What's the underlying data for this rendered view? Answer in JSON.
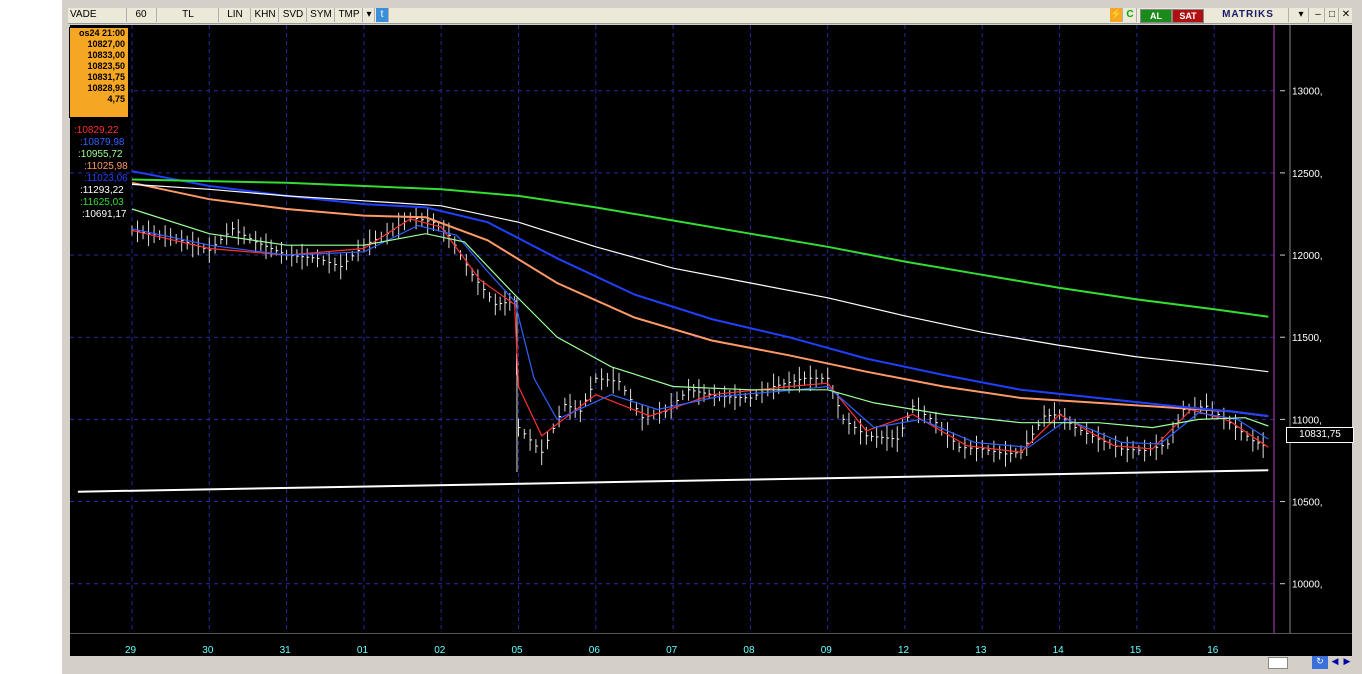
{
  "toolbar": {
    "symbol": "VADE",
    "period": "60",
    "currency": "TL",
    "scale": "LIN",
    "buttons": [
      "KHN",
      "SVD",
      "SYM",
      "TMP"
    ],
    "buy_label": "AL",
    "sell_label": "SAT",
    "brand": "MATRIKS"
  },
  "info_box": {
    "date": "os24 21:00",
    "open": "10827,00",
    "high": "10833,00",
    "low": "10823,50",
    "close": "10831,75",
    "avg": "10828,93",
    "range": "4,75"
  },
  "legend": [
    {
      "text": ":10829,22",
      "color": "#ff3030"
    },
    {
      "text": ":10879,98",
      "color": "#3060ff"
    },
    {
      "text": ":10955,72",
      "color": "#9cff9c"
    },
    {
      "text": ":11025,98",
      "color": "#ff9966"
    },
    {
      "text": ":11023,06",
      "color": "#2040ff"
    },
    {
      "text": ":11293,22",
      "color": "#ffffff"
    },
    {
      "text": ":11625,03",
      "color": "#33dd33"
    },
    {
      "text": ":10691,17",
      "color": "#ffffff"
    }
  ],
  "last_price": "10831,75",
  "chart_data": {
    "type": "line",
    "x_tick_labels": [
      "29",
      "30",
      "31",
      "01",
      "02",
      "05",
      "06",
      "07",
      "08",
      "09",
      "12",
      "13",
      "14",
      "15",
      "16"
    ],
    "y_tick_labels": [
      "13000,",
      "12500,",
      "12000,",
      "11500,",
      "11000,",
      "10500,",
      "10000,"
    ],
    "ylim": [
      9700,
      13400
    ],
    "price_path": [
      [
        0,
        12150
      ],
      [
        0.5,
        12110
      ],
      [
        1,
        12030
      ],
      [
        1.3,
        12160
      ],
      [
        1.6,
        12080
      ],
      [
        2,
        12000
      ],
      [
        2.4,
        11980
      ],
      [
        2.7,
        11930
      ],
      [
        3,
        12060
      ],
      [
        3.3,
        12130
      ],
      [
        3.6,
        12230
      ],
      [
        3.9,
        12200
      ],
      [
        4.1,
        12120
      ],
      [
        4.4,
        11880
      ],
      [
        4.7,
        11700
      ],
      [
        4.95,
        11720
      ],
      [
        5.0,
        10950
      ],
      [
        5.3,
        10800
      ],
      [
        5.6,
        11090
      ],
      [
        5.8,
        11050
      ],
      [
        6.0,
        11250
      ],
      [
        6.3,
        11230
      ],
      [
        6.6,
        11010
      ],
      [
        6.9,
        11050
      ],
      [
        7.2,
        11180
      ],
      [
        7.6,
        11140
      ],
      [
        8.0,
        11130
      ],
      [
        8.3,
        11200
      ],
      [
        8.7,
        11250
      ],
      [
        9.0,
        11250
      ],
      [
        9.2,
        11000
      ],
      [
        9.5,
        10900
      ],
      [
        9.9,
        10880
      ],
      [
        10.1,
        11080
      ],
      [
        10.4,
        10980
      ],
      [
        10.7,
        10830
      ],
      [
        11.0,
        10820
      ],
      [
        11.3,
        10790
      ],
      [
        11.5,
        10800
      ],
      [
        11.8,
        11020
      ],
      [
        12.0,
        11030
      ],
      [
        12.2,
        10950
      ],
      [
        12.5,
        10880
      ],
      [
        12.8,
        10820
      ],
      [
        13.1,
        10810
      ],
      [
        13.4,
        10850
      ],
      [
        13.6,
        11060
      ],
      [
        13.9,
        11080
      ],
      [
        14.2,
        10980
      ],
      [
        14.5,
        10870
      ],
      [
        14.7,
        10830
      ]
    ],
    "series": [
      {
        "name": "10829,22",
        "color": "#ff3030",
        "values": [
          [
            0,
            12150
          ],
          [
            1,
            12040
          ],
          [
            2,
            12000
          ],
          [
            3,
            12040
          ],
          [
            3.6,
            12220
          ],
          [
            4.0,
            12170
          ],
          [
            4.5,
            11850
          ],
          [
            4.95,
            11700
          ],
          [
            5.0,
            11200
          ],
          [
            5.3,
            10900
          ],
          [
            6,
            11150
          ],
          [
            6.7,
            11020
          ],
          [
            7.5,
            11150
          ],
          [
            8.5,
            11200
          ],
          [
            9.0,
            11220
          ],
          [
            9.5,
            10930
          ],
          [
            10.1,
            11030
          ],
          [
            10.8,
            10840
          ],
          [
            11.5,
            10800
          ],
          [
            12.0,
            11030
          ],
          [
            12.7,
            10840
          ],
          [
            13.2,
            10820
          ],
          [
            13.7,
            11060
          ],
          [
            14.2,
            10990
          ],
          [
            14.7,
            10830
          ]
        ]
      },
      {
        "name": "10879,98",
        "color": "#3060ff",
        "values": [
          [
            0,
            12160
          ],
          [
            1,
            12060
          ],
          [
            2,
            12000
          ],
          [
            3,
            12020
          ],
          [
            3.7,
            12180
          ],
          [
            4.2,
            12120
          ],
          [
            4.6,
            11900
          ],
          [
            4.95,
            11720
          ],
          [
            5.2,
            11250
          ],
          [
            5.5,
            11000
          ],
          [
            6.2,
            11150
          ],
          [
            6.8,
            11060
          ],
          [
            7.6,
            11140
          ],
          [
            8.6,
            11180
          ],
          [
            9.0,
            11200
          ],
          [
            9.6,
            10950
          ],
          [
            10.2,
            11000
          ],
          [
            10.9,
            10860
          ],
          [
            11.6,
            10830
          ],
          [
            12.1,
            11000
          ],
          [
            12.8,
            10860
          ],
          [
            13.3,
            10850
          ],
          [
            13.8,
            11040
          ],
          [
            14.3,
            11000
          ],
          [
            14.7,
            10880
          ]
        ]
      },
      {
        "name": "10955,72",
        "color": "#9cff9c",
        "values": [
          [
            0,
            12280
          ],
          [
            1,
            12130
          ],
          [
            2,
            12060
          ],
          [
            3,
            12060
          ],
          [
            3.8,
            12130
          ],
          [
            4.3,
            12080
          ],
          [
            4.95,
            11760
          ],
          [
            5.5,
            11500
          ],
          [
            6.2,
            11320
          ],
          [
            7.0,
            11200
          ],
          [
            8.0,
            11180
          ],
          [
            9.0,
            11180
          ],
          [
            9.6,
            11100
          ],
          [
            10.5,
            11030
          ],
          [
            11.5,
            10980
          ],
          [
            12.5,
            10980
          ],
          [
            13.2,
            10950
          ],
          [
            13.8,
            11000
          ],
          [
            14.4,
            11010
          ],
          [
            14.7,
            10960
          ]
        ]
      },
      {
        "name": "11025,98",
        "color": "#ff9966",
        "values": [
          [
            0,
            12440
          ],
          [
            1,
            12340
          ],
          [
            2,
            12280
          ],
          [
            3,
            12240
          ],
          [
            3.8,
            12230
          ],
          [
            4.6,
            12090
          ],
          [
            5.5,
            11830
          ],
          [
            6.5,
            11620
          ],
          [
            7.5,
            11480
          ],
          [
            8.5,
            11390
          ],
          [
            9.5,
            11290
          ],
          [
            10.5,
            11200
          ],
          [
            11.5,
            11130
          ],
          [
            12.5,
            11100
          ],
          [
            13.5,
            11070
          ],
          [
            14.2,
            11050
          ],
          [
            14.7,
            11020
          ]
        ]
      },
      {
        "name": "11023,06",
        "color": "#2040ff",
        "values": [
          [
            0,
            12510
          ],
          [
            1,
            12420
          ],
          [
            2,
            12360
          ],
          [
            3,
            12310
          ],
          [
            3.8,
            12290
          ],
          [
            4.6,
            12200
          ],
          [
            5.5,
            11980
          ],
          [
            6.5,
            11760
          ],
          [
            7.5,
            11610
          ],
          [
            8.5,
            11500
          ],
          [
            9.5,
            11370
          ],
          [
            10.5,
            11270
          ],
          [
            11.5,
            11180
          ],
          [
            12.5,
            11130
          ],
          [
            13.5,
            11080
          ],
          [
            14.2,
            11050
          ],
          [
            14.7,
            11020
          ]
        ]
      },
      {
        "name": "11293,22",
        "color": "#ffffff",
        "values": [
          [
            0,
            12430
          ],
          [
            1,
            12400
          ],
          [
            2,
            12360
          ],
          [
            3,
            12330
          ],
          [
            4,
            12300
          ],
          [
            5,
            12200
          ],
          [
            6,
            12050
          ],
          [
            7,
            11920
          ],
          [
            8,
            11830
          ],
          [
            9,
            11740
          ],
          [
            10,
            11630
          ],
          [
            11,
            11530
          ],
          [
            12,
            11450
          ],
          [
            13,
            11380
          ],
          [
            14,
            11330
          ],
          [
            14.7,
            11290
          ]
        ]
      },
      {
        "name": "11625,03",
        "color": "#33dd33",
        "values": [
          [
            0,
            12460
          ],
          [
            2,
            12440
          ],
          [
            4,
            12400
          ],
          [
            5,
            12360
          ],
          [
            6,
            12290
          ],
          [
            7,
            12210
          ],
          [
            8,
            12130
          ],
          [
            9,
            12050
          ],
          [
            10,
            11960
          ],
          [
            11,
            11880
          ],
          [
            12,
            11800
          ],
          [
            13,
            11730
          ],
          [
            14,
            11670
          ],
          [
            14.7,
            11625
          ]
        ]
      },
      {
        "name": "10691,17",
        "color": "#ffffff",
        "values": [
          [
            -0.7,
            10560
          ],
          [
            14.7,
            10690
          ]
        ]
      }
    ],
    "grid": true
  }
}
